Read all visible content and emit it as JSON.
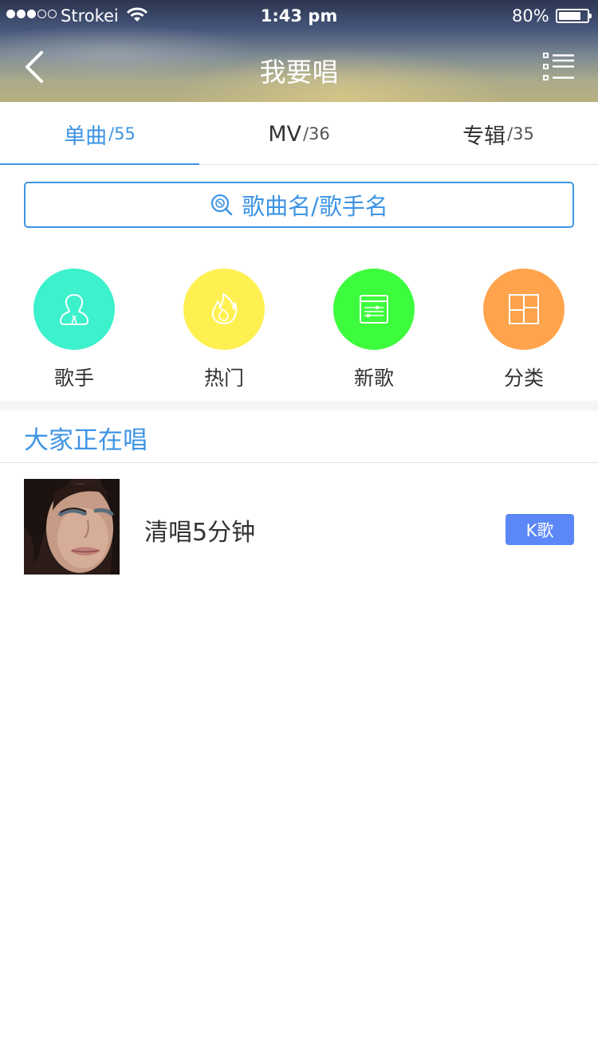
{
  "status_bar": {
    "carrier": "Strokei",
    "time": "1:43 pm",
    "battery": "80%",
    "battery_level": 0.8,
    "signal_bars_filled": 3,
    "signal_bars_total": 5
  },
  "nav": {
    "title": "我要唱",
    "back_icon": "chevron-left-icon",
    "menu_icon": "list-icon"
  },
  "tabs": [
    {
      "label": "单曲",
      "count": "/55",
      "active": true
    },
    {
      "label": "MV",
      "count": "/36",
      "active": false
    },
    {
      "label": "专辑",
      "count": "/35",
      "active": false
    }
  ],
  "search": {
    "placeholder": "歌曲名/歌手名",
    "icon": "search-icon"
  },
  "categories": [
    {
      "label": "歌手",
      "icon": "singer-icon",
      "color": "#3cf1cb"
    },
    {
      "label": "热门",
      "icon": "flame-icon",
      "color": "#fff052"
    },
    {
      "label": "新歌",
      "icon": "new-songs-icon",
      "color": "#3dfc3d"
    },
    {
      "label": "分类",
      "icon": "grid-icon",
      "color": "#ffa34c"
    }
  ],
  "section": {
    "title": "大家正在唱"
  },
  "songs": [
    {
      "name": "清唱5分钟",
      "button": "K歌"
    }
  ],
  "colors": {
    "accent": "#3e94e4",
    "k_button": "#5b87f7"
  }
}
